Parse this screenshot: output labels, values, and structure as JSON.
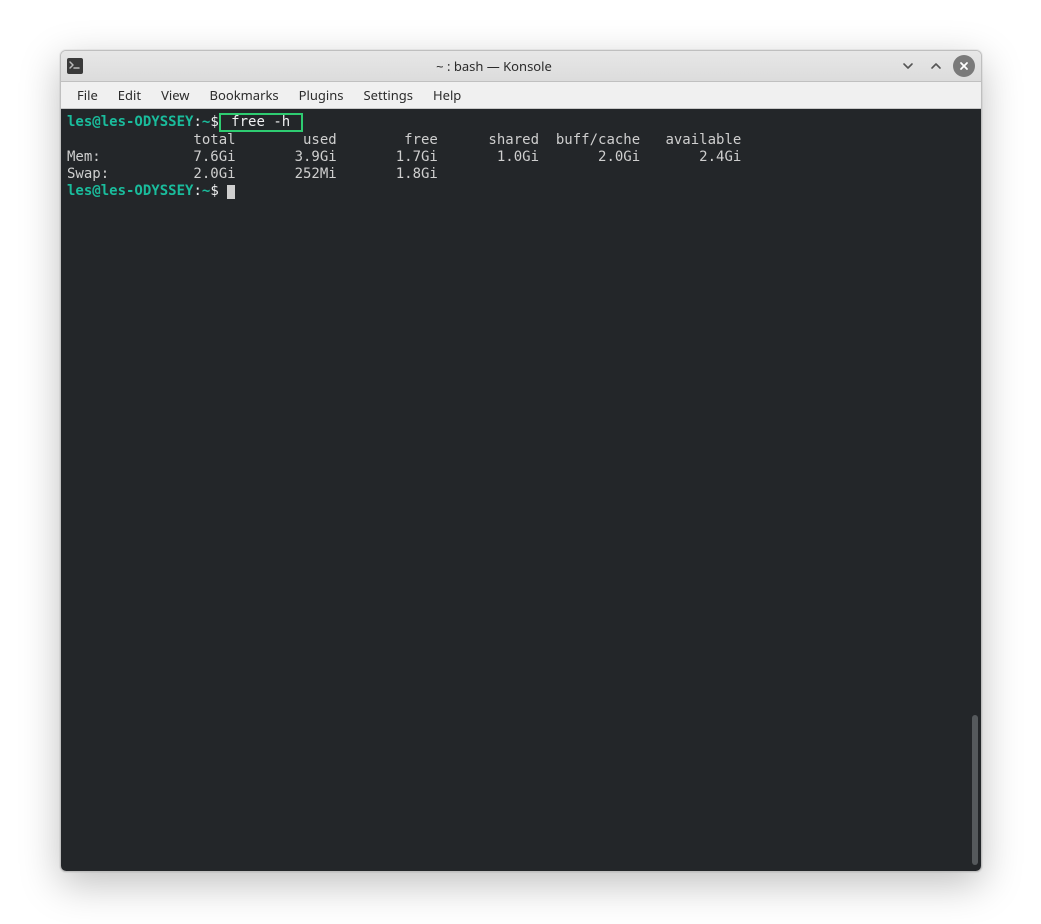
{
  "window": {
    "title": "~ : bash — Konsole"
  },
  "menu": {
    "file": "File",
    "edit": "Edit",
    "view": "View",
    "bookmarks": "Bookmarks",
    "plugins": "Plugins",
    "settings": "Settings",
    "help": "Help"
  },
  "terminal": {
    "prompt1_userhost": "les@les-ODYSSEY",
    "prompt1_sep": ":",
    "prompt1_path": "~",
    "prompt1_dollar": "$",
    "command1": " free -h ",
    "header_line": "               total        used        free      shared  buff/cache   available",
    "mem_line": "Mem:           7.6Gi       3.9Gi       1.7Gi       1.0Gi       2.0Gi       2.4Gi",
    "swap_line": "Swap:          2.0Gi       252Mi       1.8Gi",
    "prompt2_userhost": "les@les-ODYSSEY",
    "prompt2_sep": ":",
    "prompt2_path": "~",
    "prompt2_dollar": "$"
  }
}
